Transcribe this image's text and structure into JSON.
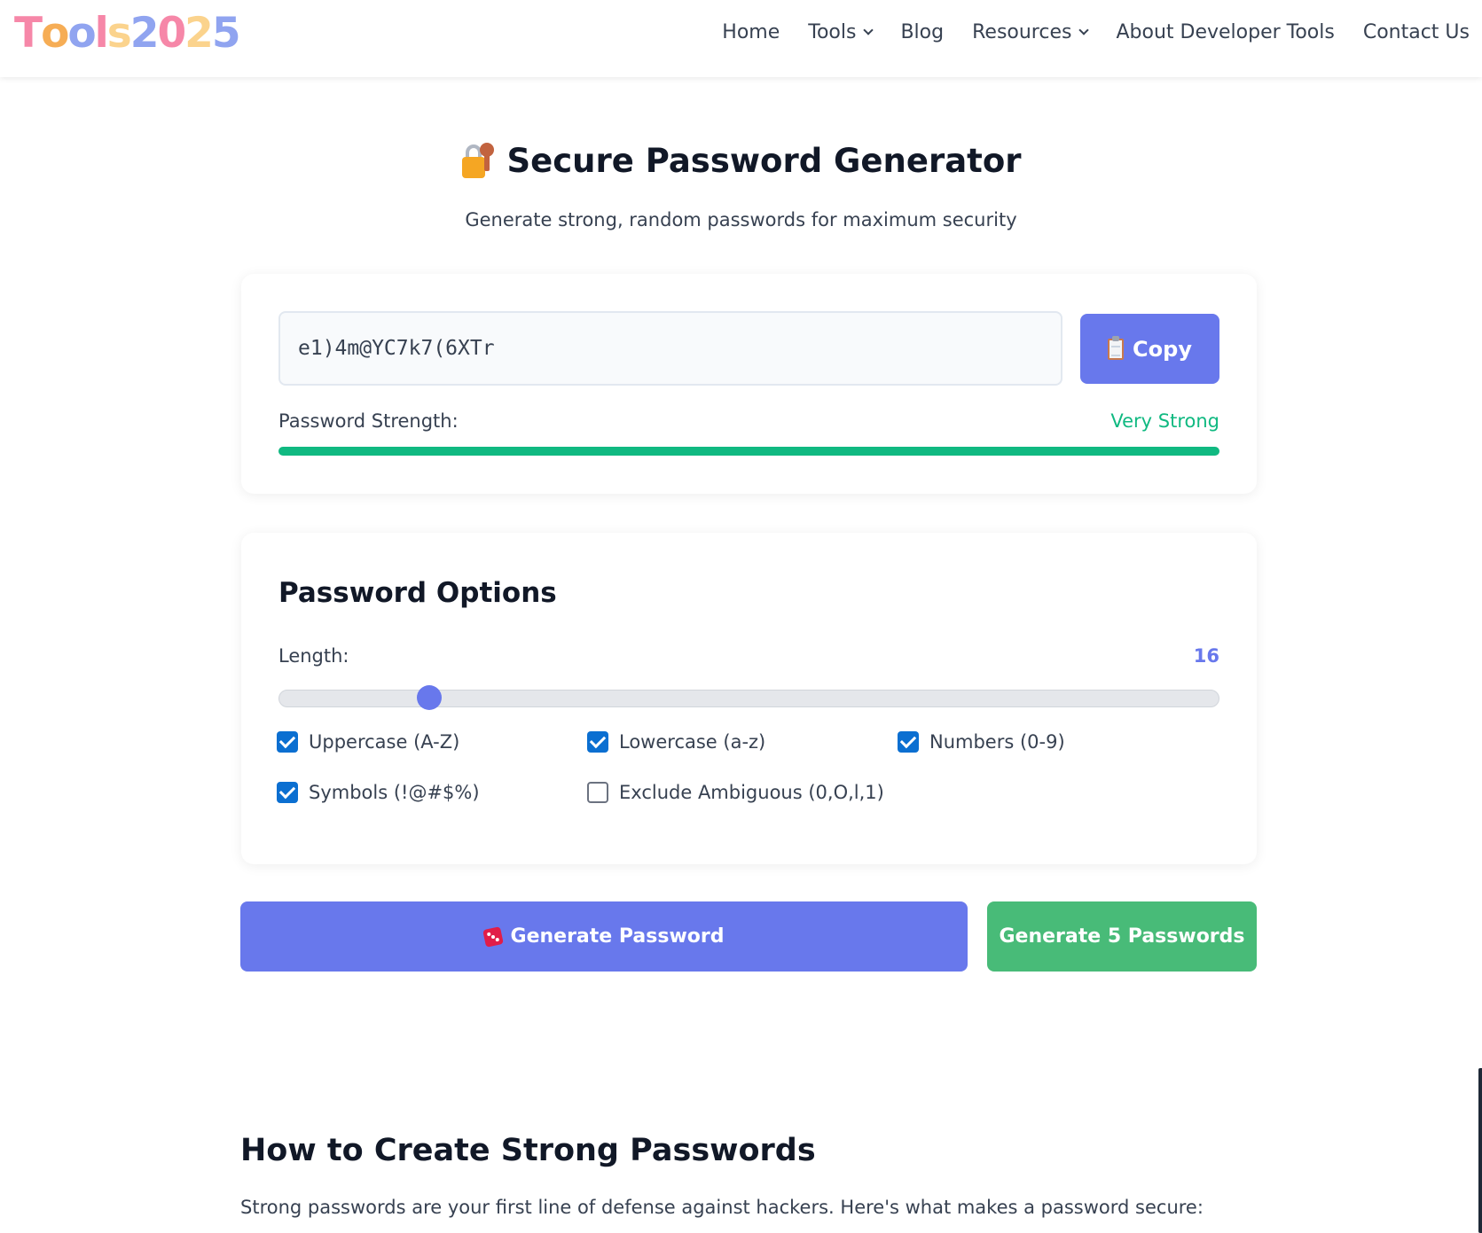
{
  "header": {
    "logo_letters": [
      {
        "char": "T",
        "color": "#f687a8"
      },
      {
        "char": "o",
        "color": "#f6ad55"
      },
      {
        "char": "o",
        "color": "#90a4f0"
      },
      {
        "char": "l",
        "color": "#f687a8"
      },
      {
        "char": "s",
        "color": "#fbd38d"
      },
      {
        "char": "2",
        "color": "#90a4f0"
      },
      {
        "char": "0",
        "color": "#f687a8"
      },
      {
        "char": "2",
        "color": "#fbd38d"
      },
      {
        "char": "5",
        "color": "#90a4f0"
      }
    ],
    "nav": {
      "home": "Home",
      "tools": "Tools",
      "blog": "Blog",
      "resources": "Resources",
      "about": "About Developer Tools",
      "contact": "Contact Us"
    }
  },
  "page": {
    "title": "Secure Password Generator",
    "title_icon": "lock-with-key-icon",
    "subtitle": "Generate strong, random passwords for maximum security"
  },
  "output": {
    "password": "e1)4m@YC7k7(6XTr",
    "copy_label": "Copy",
    "copy_icon": "clipboard-icon",
    "strength_label": "Password Strength:",
    "strength_value": "Very Strong",
    "strength_fraction": 1.0,
    "strength_color": "#10b981"
  },
  "options": {
    "title": "Password Options",
    "length_label": "Length:",
    "length_value": "16",
    "length_slider_fraction": 0.16,
    "uppercase": {
      "label": "Uppercase (A-Z)",
      "checked": true
    },
    "lowercase": {
      "label": "Lowercase (a-z)",
      "checked": true
    },
    "numbers": {
      "label": "Numbers (0-9)",
      "checked": true
    },
    "symbols": {
      "label": "Symbols (!@#$%)",
      "checked": true
    },
    "exclude_ambiguous": {
      "label": "Exclude Ambiguous (0,O,l,1)",
      "checked": false
    }
  },
  "actions": {
    "generate_label": "Generate Password",
    "generate_icon": "dice-icon",
    "generate5_label": "Generate 5 Passwords"
  },
  "info": {
    "heading": "How to Create Strong Passwords",
    "intro": "Strong passwords are your first line of defense against hackers. Here's what makes a password secure:"
  },
  "colors": {
    "accent": "#6878ec",
    "success": "#48bb78",
    "checkbox": "#0b6fd1"
  }
}
